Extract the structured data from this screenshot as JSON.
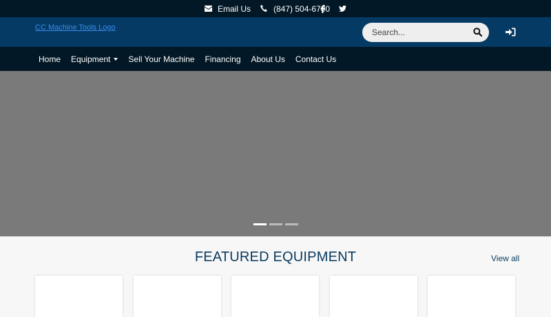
{
  "topbar": {
    "email_label": "Email Us",
    "phone_label": "(847) 504-6700",
    "icons": [
      "envelope-icon",
      "phone-icon",
      "facebook-icon",
      "twitter-icon"
    ]
  },
  "header": {
    "logo_text": "CC Machine Tools Logo",
    "search_placeholder": "Search..."
  },
  "nav": {
    "items": [
      "Home",
      "Equipment",
      "Sell Your Machine",
      "Financing",
      "About Us",
      "Contact Us"
    ]
  },
  "carousel": {
    "slide_count": 3,
    "active_index": 0
  },
  "featured": {
    "title": "FEATURED EQUIPMENT",
    "view_all": "View all"
  },
  "colors": {
    "topbar": "#031826",
    "header": "#043a63",
    "hero": "#7a7a7a",
    "accent": "#073a5f"
  }
}
